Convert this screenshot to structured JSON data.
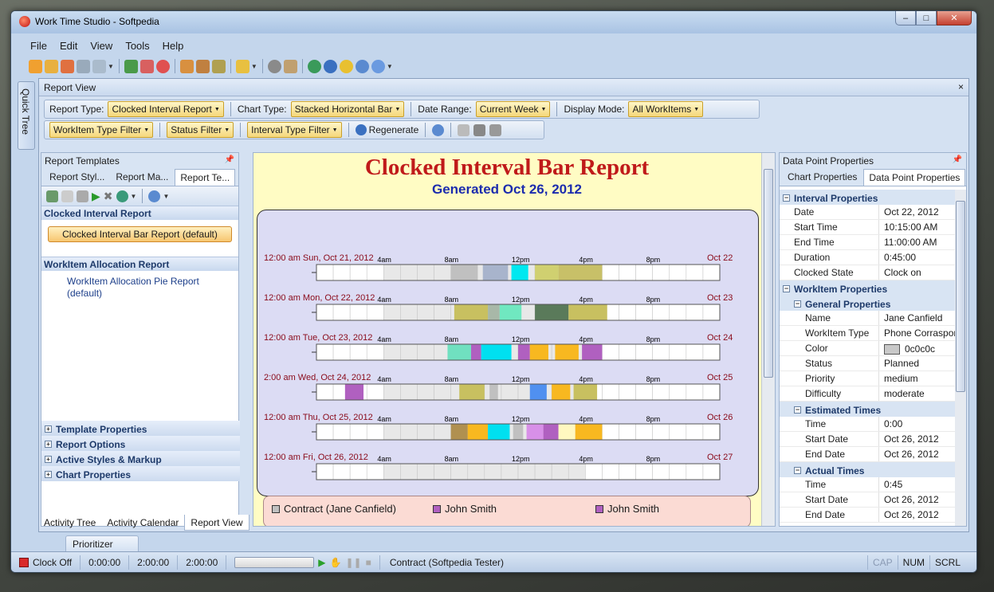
{
  "window": {
    "title": "Work Time Studio - Softpedia",
    "min": "–",
    "max": "□",
    "close": "✕"
  },
  "menu": [
    "File",
    "Edit",
    "View",
    "Tools",
    "Help"
  ],
  "side_tab": "Quick Tree",
  "report_view": {
    "title": "Report View",
    "close": "×"
  },
  "options": {
    "report_type_label": "Report Type:",
    "report_type": "Clocked Interval Report",
    "chart_type_label": "Chart Type:",
    "chart_type": "Stacked Horizontal Bar",
    "date_range_label": "Date Range:",
    "date_range": "Current Week",
    "display_mode_label": "Display Mode:",
    "display_mode": "All WorkItems",
    "workitem_filter": "WorkItem Type Filter",
    "status_filter": "Status Filter",
    "interval_filter": "Interval Type Filter",
    "regenerate": "Regenerate"
  },
  "left_panel": {
    "title": "Report Templates",
    "tabs": [
      "Report Styl...",
      "Report Ma...",
      "Report Te..."
    ],
    "groups": [
      {
        "title": "Clocked Interval Report",
        "item": "Clocked Interval Bar Report (default)"
      },
      {
        "title": "WorkItem Allocation Report",
        "item": "WorkItem Allocation Pie Report (default)"
      }
    ],
    "props": [
      "Template Properties",
      "Report Options",
      "Active Styles & Markup",
      "Chart Properties"
    ]
  },
  "report": {
    "title": "Clocked Interval Bar Report",
    "subtitle": "Generated Oct 26, 2012"
  },
  "chart_data": {
    "type": "bar",
    "ticks": [
      "4am",
      "8am",
      "12pm",
      "4pm",
      "8pm"
    ],
    "rows": [
      {
        "start": "12:00 am Sun, Oct 21, 2012",
        "end": "Oct 22",
        "segments": [
          [
            8,
            9.6,
            "#c0c0c0"
          ],
          [
            9.9,
            11.4,
            "#a8b4cc"
          ],
          [
            11.6,
            12.6,
            "#00e8f0"
          ],
          [
            13,
            14.4,
            "#d0d070"
          ],
          [
            14.4,
            17,
            "#c8c068"
          ]
        ]
      },
      {
        "start": "12:00 am Mon, Oct 22, 2012",
        "end": "Oct 23",
        "segments": [
          [
            8.2,
            10.2,
            "#c8c060"
          ],
          [
            10.2,
            10.9,
            "#a8b8a8"
          ],
          [
            10.9,
            12.2,
            "#70e8c0"
          ],
          [
            13,
            15,
            "#5a7a5a"
          ],
          [
            15,
            17.3,
            "#c8c060"
          ]
        ]
      },
      {
        "start": "12:00 am Tue, Oct 23, 2012",
        "end": "Oct 24",
        "segments": [
          [
            7.8,
            9.2,
            "#70e0c0"
          ],
          [
            9.2,
            9.8,
            "#b060c0"
          ],
          [
            9.8,
            11.6,
            "#00e0f0"
          ],
          [
            12,
            12.7,
            "#b060c0"
          ],
          [
            12.7,
            13.8,
            "#f8b820"
          ],
          [
            14.2,
            15.6,
            "#f8b820"
          ],
          [
            15.8,
            17,
            "#b060c0"
          ]
        ]
      },
      {
        "start": "2:00 am Wed, Oct 24, 2012",
        "end": "Oct 25",
        "segments": [
          [
            1.7,
            2.8,
            "#b060c0"
          ],
          [
            8.5,
            10,
            "#c8c060"
          ],
          [
            10.3,
            10.8,
            "#c0c0c0"
          ],
          [
            12.7,
            13.7,
            "#5090f0"
          ],
          [
            14,
            15.1,
            "#f8b820"
          ],
          [
            15.3,
            16.7,
            "#c8c060"
          ]
        ]
      },
      {
        "start": "12:00 am Thu, Oct 25, 2012",
        "end": "Oct 26",
        "segments": [
          [
            8,
            9,
            "#b09050"
          ],
          [
            9,
            10.2,
            "#f8b820"
          ],
          [
            10.2,
            11.5,
            "#00e0f0"
          ],
          [
            11.7,
            12.3,
            "#c0c0c0"
          ],
          [
            12.5,
            13.5,
            "#d890e8"
          ],
          [
            13.5,
            14.4,
            "#b060c0"
          ],
          [
            14.4,
            15.4,
            "#fff8c0"
          ],
          [
            15.4,
            17,
            "#f8b820"
          ]
        ]
      },
      {
        "start": "12:00 am Fri, Oct 26, 2012",
        "end": "Oct 27",
        "segments": []
      }
    ],
    "xlim": [
      0,
      24
    ]
  },
  "legend": [
    {
      "label": "Contract (Jane Canfield)",
      "color": "#c0c0c0"
    },
    {
      "label": "John Smith",
      "color": "#b060c0"
    },
    {
      "label": "John Smith",
      "color": "#b060c0"
    }
  ],
  "right_panel": {
    "title": "Data Point Properties",
    "tabs": [
      "Chart Properties",
      "Data Point Properties"
    ],
    "cat_interval": "Interval Properties",
    "interval": [
      [
        "Date",
        "Oct 22, 2012"
      ],
      [
        "Start Time",
        "10:15:00 AM"
      ],
      [
        "End Time",
        "11:00:00 AM"
      ],
      [
        "Duration",
        "0:45:00"
      ],
      [
        "Clocked State",
        "Clock on"
      ]
    ],
    "cat_workitem": "WorkItem Properties",
    "cat_general": "General Properties",
    "general": [
      [
        "Name",
        "Jane Canfield"
      ],
      [
        "WorkItem Type",
        "Phone Corraspondance"
      ]
    ],
    "color_label": "Color",
    "color_value": "0c0c0c",
    "general2": [
      [
        "Status",
        "Planned"
      ],
      [
        "Priority",
        "medium"
      ],
      [
        "Difficulty",
        "moderate"
      ]
    ],
    "cat_estimated": "Estimated Times",
    "estimated": [
      [
        "Time",
        "0:00"
      ],
      [
        "Start Date",
        "Oct 26, 2012"
      ],
      [
        "End Date",
        "Oct 26, 2012"
      ]
    ],
    "cat_actual": "Actual Times",
    "actual": [
      [
        "Time",
        "0:45"
      ],
      [
        "Start Date",
        "Oct 26, 2012"
      ],
      [
        "End Date",
        "Oct 26, 2012"
      ]
    ]
  },
  "bottom_tabs": [
    "Activity Tree",
    "Activity Calendar",
    "Report View"
  ],
  "prioritizer": "Prioritizer",
  "status": {
    "clock": "Clock Off",
    "t1": "0:00:00",
    "t2": "2:00:00",
    "t3": "2:00:00",
    "activity": "Contract (Softpedia Tester)",
    "cap": "CAP",
    "num": "NUM",
    "scrl": "SCRL"
  }
}
